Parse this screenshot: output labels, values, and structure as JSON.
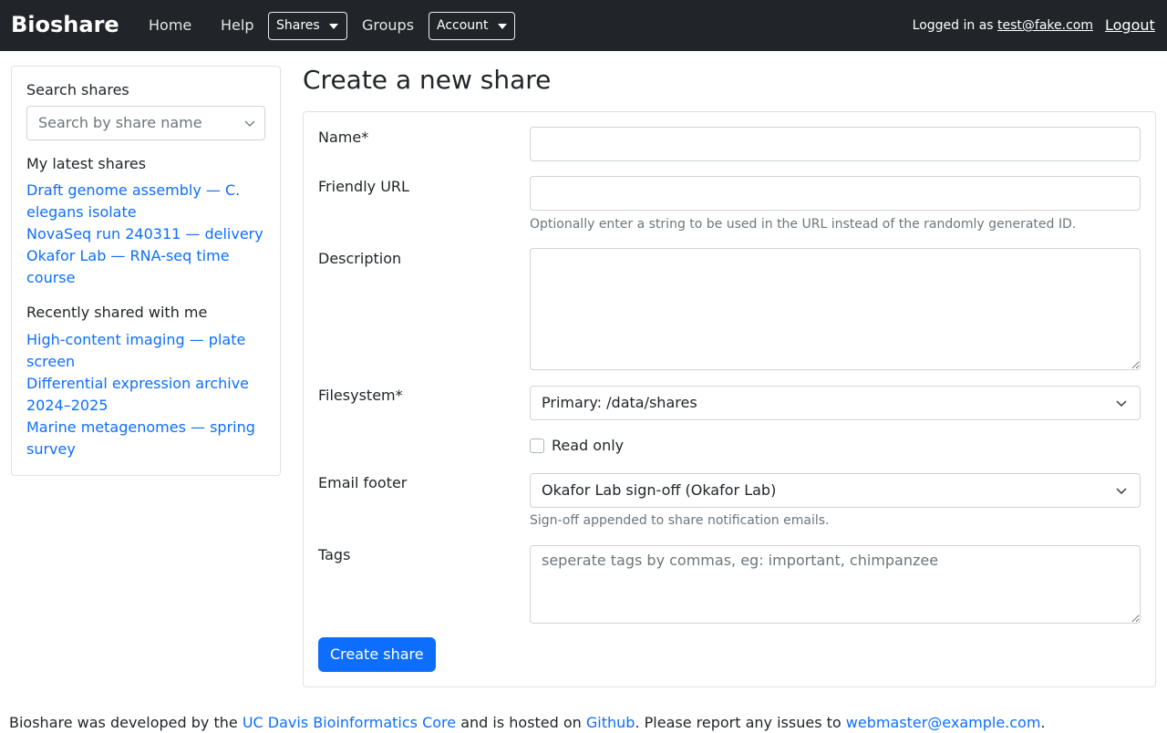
{
  "nav": {
    "brand": "Bioshare",
    "home": "Home",
    "help": "Help",
    "shares": "Shares",
    "groups": "Groups",
    "account": "Account",
    "logged_in_prefix": "Logged in as ",
    "user_email": "test@fake.com",
    "logout": "Logout"
  },
  "sidebar": {
    "search_heading": "Search shares",
    "search_placeholder": "Search by share name",
    "latest_heading": "My latest shares",
    "latest_items": [
      "Draft genome assembly — C. elegans isolate",
      "NovaSeq run 240311 — delivery",
      "Okafor Lab — RNA-seq time course"
    ],
    "shared_heading": "Recently shared with me",
    "shared_items": [
      "High-content imaging — plate screen",
      "Differential expression archive 2024–2025",
      "Marine metagenomes — spring survey"
    ]
  },
  "form": {
    "title": "Create a new share",
    "name_label": "Name*",
    "name_value": "",
    "url_label": "Friendly URL",
    "url_value": "",
    "url_help": "Optionally enter a string to be used in the URL instead of the randomly generated ID.",
    "description_label": "Description",
    "description_value": "",
    "filesystem_label": "Filesystem*",
    "filesystem_value": "Primary: /data/shares",
    "readonly_label": "Read only",
    "email_footer_label": "Email footer",
    "email_footer_value": "Okafor Lab sign-off (Okafor Lab)",
    "email_footer_help": "Sign-off appended to share notification emails.",
    "tags_label": "Tags",
    "tags_placeholder": "seperate tags by commas, eg: important, chimpanzee",
    "submit_label": "Create share"
  },
  "footer": {
    "text1": "Bioshare was developed by the ",
    "link1": "UC Davis Bioinformatics Core",
    "text2": " and is hosted on ",
    "link2": "Github",
    "text3": ". Please report any issues to ",
    "link3": "webmaster@example.com",
    "text4": "."
  }
}
